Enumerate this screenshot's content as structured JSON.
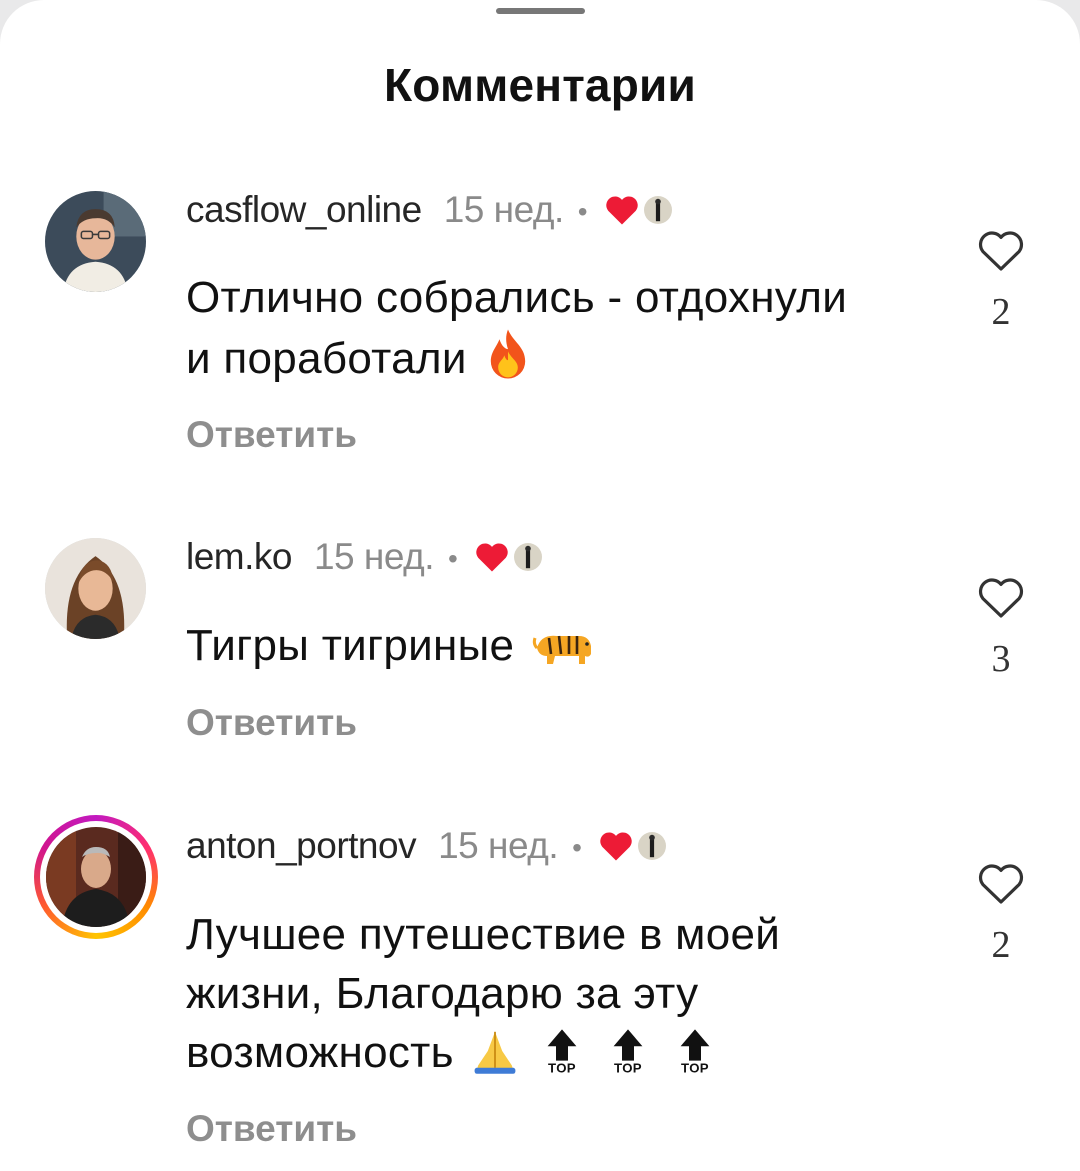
{
  "sheet": {
    "title": "Комментарии"
  },
  "comments": [
    {
      "username": "casflow_online",
      "time": "15 нед.",
      "dot": "•",
      "text": "Отлично собрались - отдохнули и поработали",
      "emoji": "fire-icon",
      "reply": "Ответить",
      "likes": "2",
      "has_story_ring": false
    },
    {
      "username": "lem.ko",
      "time": "15 нед.",
      "dot": "•",
      "text": "Тигры тигриные",
      "emoji": "tiger-icon",
      "reply": "Ответить",
      "likes": "3",
      "has_story_ring": false
    },
    {
      "username": "anton_portnov",
      "time": "15 нед.",
      "dot": "•",
      "text": "Лучшее путешествие в моей жизни, Благодарю за эту возможность",
      "emoji_sequence": [
        "folded-hands-icon",
        "top-arrow-icon",
        "top-arrow-icon",
        "top-arrow-icon"
      ],
      "top_label": "TOP",
      "reply": "Ответить",
      "likes": "2",
      "has_story_ring": true
    }
  ],
  "colors": {
    "liked_heart": "#ed1b36",
    "story_ring": [
      "#c21ac0",
      "#ff2d6f",
      "#ff8a00",
      "#ffc400"
    ]
  }
}
